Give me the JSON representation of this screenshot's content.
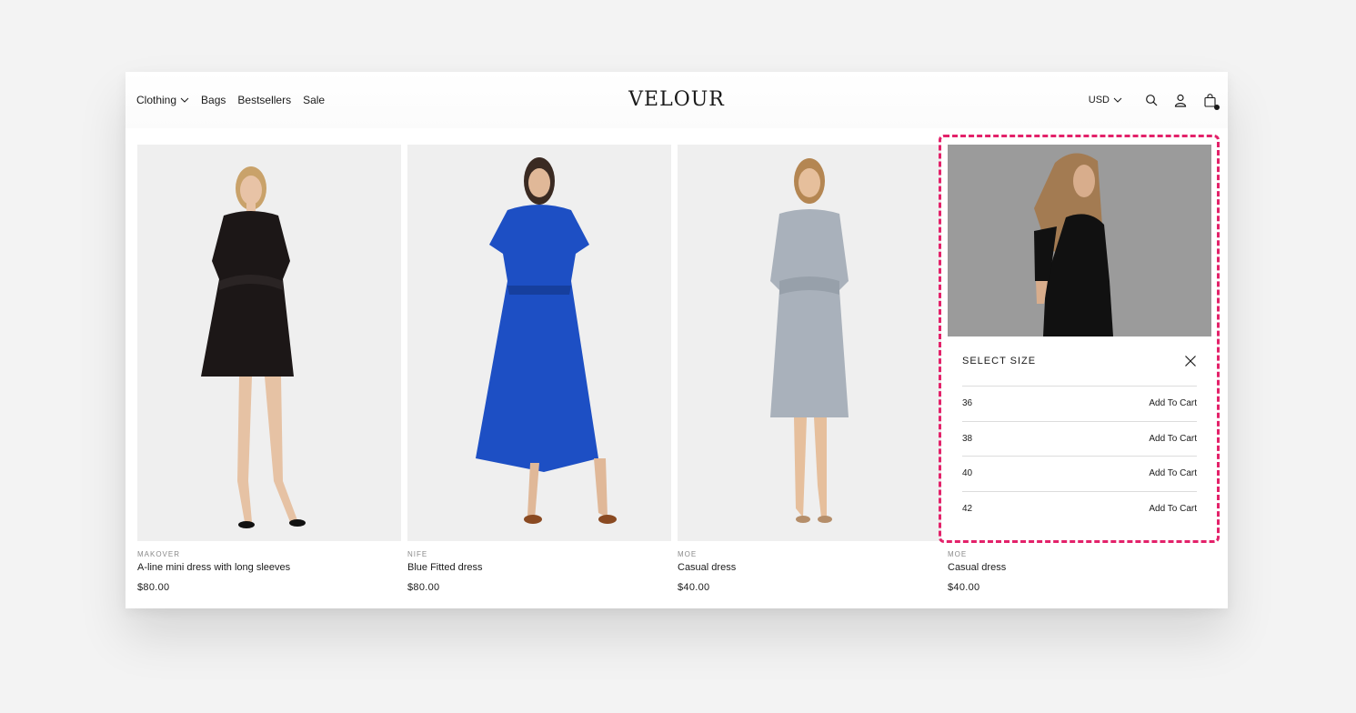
{
  "header": {
    "nav": [
      {
        "label": "Clothing",
        "dropdown": true
      },
      {
        "label": "Bags",
        "dropdown": false
      },
      {
        "label": "Bestsellers",
        "dropdown": false
      },
      {
        "label": "Sale",
        "dropdown": false
      }
    ],
    "logo": "VELOUR",
    "currency": "USD",
    "icons": [
      "search-icon",
      "account-icon",
      "cart-icon"
    ]
  },
  "products": [
    {
      "brand": "MAKOVER",
      "name": "A-line mini dress with long sleeves",
      "price": "$80.00",
      "dress_color": "#1c1717",
      "bg": "#efefef"
    },
    {
      "brand": "NIFE",
      "name": "Blue Fitted dress",
      "price": "$80.00",
      "dress_color": "#1d4fc4",
      "bg": "#f0f0f0"
    },
    {
      "brand": "MOE",
      "name": "Casual dress",
      "price": "$40.00",
      "dress_color": "#a9b1bb",
      "bg": "#f0f0f0"
    },
    {
      "brand": "MOE",
      "name": "Casual dress",
      "price": "$40.00",
      "dress_color": "#111111",
      "bg": "#9b9b9b"
    }
  ],
  "size_popup": {
    "title": "SELECT SIZE",
    "sizes": [
      {
        "size": "36",
        "action": "Add To Cart"
      },
      {
        "size": "38",
        "action": "Add To Cart"
      },
      {
        "size": "40",
        "action": "Add To Cart"
      },
      {
        "size": "42",
        "action": "Add To Cart"
      }
    ]
  },
  "colors": {
    "highlight": "#e3226a",
    "text": "#1a1a1a",
    "muted": "#8a8a8a"
  }
}
